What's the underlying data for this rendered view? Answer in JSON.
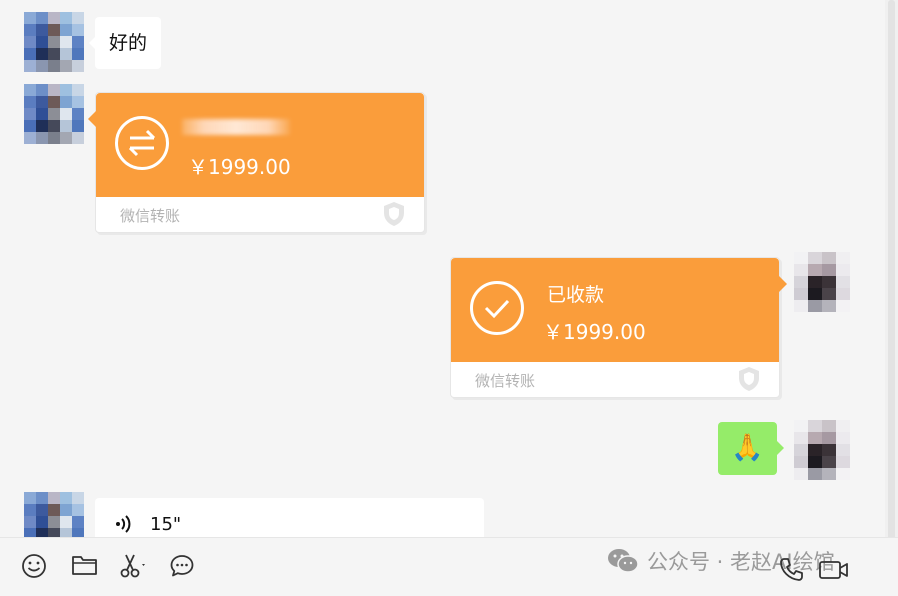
{
  "messages": {
    "text_1": "好的",
    "transfer_in": {
      "amount": "￥1999.00",
      "footer": "微信转账"
    },
    "transfer_received": {
      "title": "已收款",
      "amount": "￥1999.00",
      "footer": "微信转账"
    },
    "emoji": "🙏",
    "voice": {
      "duration": "15\""
    }
  },
  "toolbar": {
    "icons": [
      "emoji-icon",
      "folder-icon",
      "scissors-icon",
      "chat-bubble-icon",
      "phone-icon",
      "video-call-icon"
    ],
    "watermark": "公众号 · 老赵AI绘馆"
  },
  "colors": {
    "transfer_orange": "#fa9d3b",
    "self_bubble_green": "#95ec69",
    "background": "#f5f5f5"
  }
}
